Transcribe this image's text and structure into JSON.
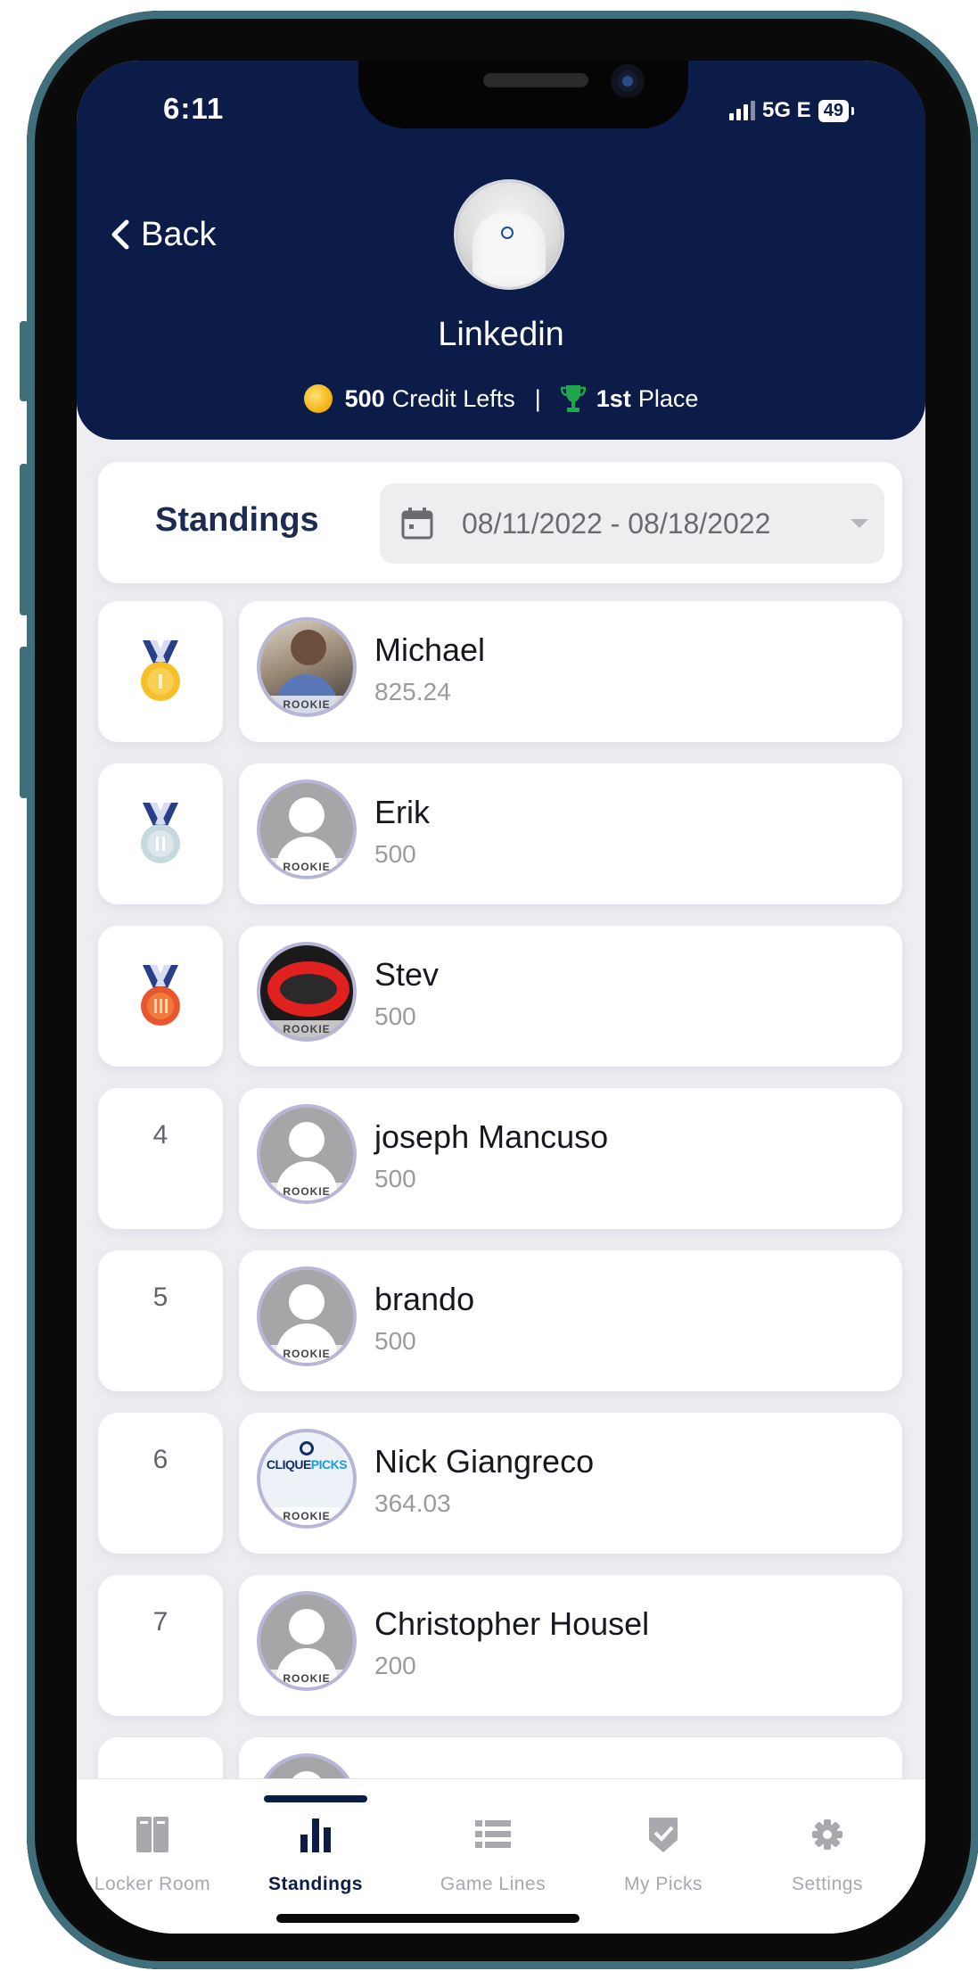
{
  "status_bar": {
    "time": "6:11",
    "network": "5G E",
    "battery": "49"
  },
  "header": {
    "back_label": "Back",
    "team_name": "Linkedin",
    "credits_value": "500",
    "credits_label": "Credit Lefts",
    "separator": "|",
    "place_value": "1st",
    "place_label": "Place",
    "colors": {
      "background": "#0b1c48",
      "accent_coin": "#f3b410",
      "trophy": "#1fa84a"
    }
  },
  "standings": {
    "title": "Standings",
    "date_range": "08/11/2022 - 08/18/2022",
    "rows": [
      {
        "rank": "1",
        "medal": "gold",
        "name": "Michael",
        "score": "825.24",
        "badge": "ROOKIE",
        "avatar": "photo"
      },
      {
        "rank": "2",
        "medal": "silver",
        "name": "Erik",
        "score": "500",
        "badge": "ROOKIE",
        "avatar": "default"
      },
      {
        "rank": "3",
        "medal": "bronze",
        "name": "Stev",
        "score": "500",
        "badge": "ROOKIE",
        "avatar": "photo"
      },
      {
        "rank": "4",
        "medal": "",
        "name": "joseph Mancuso",
        "score": "500",
        "badge": "ROOKIE",
        "avatar": "default"
      },
      {
        "rank": "5",
        "medal": "",
        "name": "brando",
        "score": "500",
        "badge": "ROOKIE",
        "avatar": "default"
      },
      {
        "rank": "6",
        "medal": "",
        "name": "Nick Giangreco",
        "score": "364.03",
        "badge": "ROOKIE",
        "avatar": "logo"
      },
      {
        "rank": "7",
        "medal": "",
        "name": "Christopher Housel",
        "score": "200",
        "badge": "ROOKIE",
        "avatar": "default"
      }
    ],
    "clique_logo_text": {
      "part1": "CLIQUE",
      "part2": "PICKS"
    }
  },
  "tabbar": {
    "tabs": [
      {
        "label": "Locker Room",
        "icon": "locker-icon",
        "active": false
      },
      {
        "label": "Standings",
        "icon": "bar-chart-icon",
        "active": true
      },
      {
        "label": "Game Lines",
        "icon": "list-icon",
        "active": false
      },
      {
        "label": "My Picks",
        "icon": "shield-check-icon",
        "active": false
      },
      {
        "label": "Settings",
        "icon": "gear-icon",
        "active": false
      }
    ]
  }
}
